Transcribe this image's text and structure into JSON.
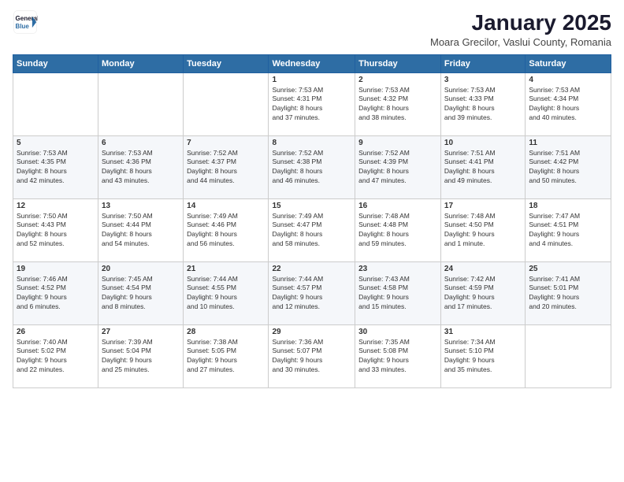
{
  "header": {
    "logo_line1": "General",
    "logo_line2": "Blue",
    "title": "January 2025",
    "subtitle": "Moara Grecilor, Vaslui County, Romania"
  },
  "weekdays": [
    "Sunday",
    "Monday",
    "Tuesday",
    "Wednesday",
    "Thursday",
    "Friday",
    "Saturday"
  ],
  "weeks": [
    [
      {
        "day": "",
        "info": ""
      },
      {
        "day": "",
        "info": ""
      },
      {
        "day": "",
        "info": ""
      },
      {
        "day": "1",
        "info": "Sunrise: 7:53 AM\nSunset: 4:31 PM\nDaylight: 8 hours\nand 37 minutes."
      },
      {
        "day": "2",
        "info": "Sunrise: 7:53 AM\nSunset: 4:32 PM\nDaylight: 8 hours\nand 38 minutes."
      },
      {
        "day": "3",
        "info": "Sunrise: 7:53 AM\nSunset: 4:33 PM\nDaylight: 8 hours\nand 39 minutes."
      },
      {
        "day": "4",
        "info": "Sunrise: 7:53 AM\nSunset: 4:34 PM\nDaylight: 8 hours\nand 40 minutes."
      }
    ],
    [
      {
        "day": "5",
        "info": "Sunrise: 7:53 AM\nSunset: 4:35 PM\nDaylight: 8 hours\nand 42 minutes."
      },
      {
        "day": "6",
        "info": "Sunrise: 7:53 AM\nSunset: 4:36 PM\nDaylight: 8 hours\nand 43 minutes."
      },
      {
        "day": "7",
        "info": "Sunrise: 7:52 AM\nSunset: 4:37 PM\nDaylight: 8 hours\nand 44 minutes."
      },
      {
        "day": "8",
        "info": "Sunrise: 7:52 AM\nSunset: 4:38 PM\nDaylight: 8 hours\nand 46 minutes."
      },
      {
        "day": "9",
        "info": "Sunrise: 7:52 AM\nSunset: 4:39 PM\nDaylight: 8 hours\nand 47 minutes."
      },
      {
        "day": "10",
        "info": "Sunrise: 7:51 AM\nSunset: 4:41 PM\nDaylight: 8 hours\nand 49 minutes."
      },
      {
        "day": "11",
        "info": "Sunrise: 7:51 AM\nSunset: 4:42 PM\nDaylight: 8 hours\nand 50 minutes."
      }
    ],
    [
      {
        "day": "12",
        "info": "Sunrise: 7:50 AM\nSunset: 4:43 PM\nDaylight: 8 hours\nand 52 minutes."
      },
      {
        "day": "13",
        "info": "Sunrise: 7:50 AM\nSunset: 4:44 PM\nDaylight: 8 hours\nand 54 minutes."
      },
      {
        "day": "14",
        "info": "Sunrise: 7:49 AM\nSunset: 4:46 PM\nDaylight: 8 hours\nand 56 minutes."
      },
      {
        "day": "15",
        "info": "Sunrise: 7:49 AM\nSunset: 4:47 PM\nDaylight: 8 hours\nand 58 minutes."
      },
      {
        "day": "16",
        "info": "Sunrise: 7:48 AM\nSunset: 4:48 PM\nDaylight: 8 hours\nand 59 minutes."
      },
      {
        "day": "17",
        "info": "Sunrise: 7:48 AM\nSunset: 4:50 PM\nDaylight: 9 hours\nand 1 minute."
      },
      {
        "day": "18",
        "info": "Sunrise: 7:47 AM\nSunset: 4:51 PM\nDaylight: 9 hours\nand 4 minutes."
      }
    ],
    [
      {
        "day": "19",
        "info": "Sunrise: 7:46 AM\nSunset: 4:52 PM\nDaylight: 9 hours\nand 6 minutes."
      },
      {
        "day": "20",
        "info": "Sunrise: 7:45 AM\nSunset: 4:54 PM\nDaylight: 9 hours\nand 8 minutes."
      },
      {
        "day": "21",
        "info": "Sunrise: 7:44 AM\nSunset: 4:55 PM\nDaylight: 9 hours\nand 10 minutes."
      },
      {
        "day": "22",
        "info": "Sunrise: 7:44 AM\nSunset: 4:57 PM\nDaylight: 9 hours\nand 12 minutes."
      },
      {
        "day": "23",
        "info": "Sunrise: 7:43 AM\nSunset: 4:58 PM\nDaylight: 9 hours\nand 15 minutes."
      },
      {
        "day": "24",
        "info": "Sunrise: 7:42 AM\nSunset: 4:59 PM\nDaylight: 9 hours\nand 17 minutes."
      },
      {
        "day": "25",
        "info": "Sunrise: 7:41 AM\nSunset: 5:01 PM\nDaylight: 9 hours\nand 20 minutes."
      }
    ],
    [
      {
        "day": "26",
        "info": "Sunrise: 7:40 AM\nSunset: 5:02 PM\nDaylight: 9 hours\nand 22 minutes."
      },
      {
        "day": "27",
        "info": "Sunrise: 7:39 AM\nSunset: 5:04 PM\nDaylight: 9 hours\nand 25 minutes."
      },
      {
        "day": "28",
        "info": "Sunrise: 7:38 AM\nSunset: 5:05 PM\nDaylight: 9 hours\nand 27 minutes."
      },
      {
        "day": "29",
        "info": "Sunrise: 7:36 AM\nSunset: 5:07 PM\nDaylight: 9 hours\nand 30 minutes."
      },
      {
        "day": "30",
        "info": "Sunrise: 7:35 AM\nSunset: 5:08 PM\nDaylight: 9 hours\nand 33 minutes."
      },
      {
        "day": "31",
        "info": "Sunrise: 7:34 AM\nSunset: 5:10 PM\nDaylight: 9 hours\nand 35 minutes."
      },
      {
        "day": "",
        "info": ""
      }
    ]
  ]
}
